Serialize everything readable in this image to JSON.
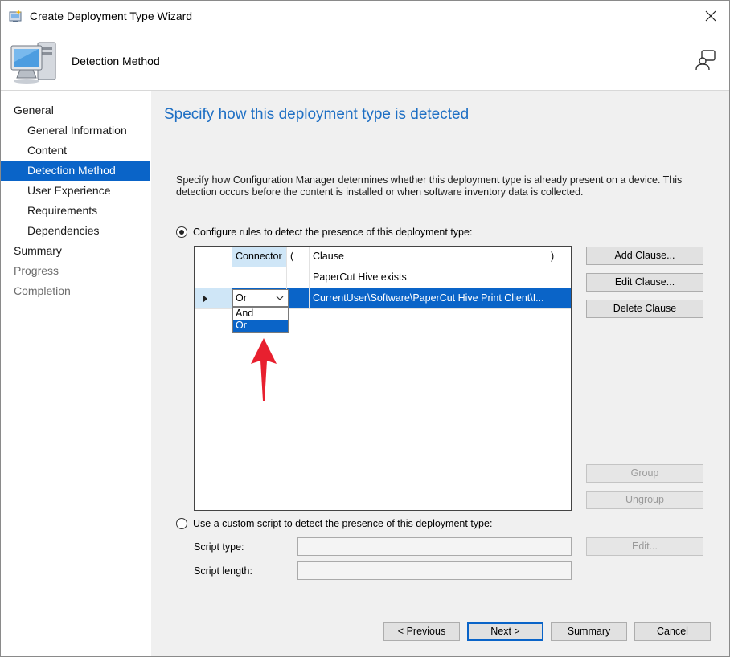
{
  "window": {
    "title": "Create Deployment Type Wizard",
    "close_icon": "close-icon",
    "app_icon": "wizard-icon"
  },
  "header": {
    "title": "Detection Method",
    "icon": "computer-icon",
    "help_icon": "help-person-icon"
  },
  "nav": {
    "items": [
      {
        "label": "General",
        "level": 0,
        "state": "normal"
      },
      {
        "label": "General Information",
        "level": 1,
        "state": "normal"
      },
      {
        "label": "Content",
        "level": 1,
        "state": "normal"
      },
      {
        "label": "Detection Method",
        "level": 1,
        "state": "active"
      },
      {
        "label": "User Experience",
        "level": 1,
        "state": "normal"
      },
      {
        "label": "Requirements",
        "level": 1,
        "state": "normal"
      },
      {
        "label": "Dependencies",
        "level": 1,
        "state": "normal"
      },
      {
        "label": "Summary",
        "level": 0,
        "state": "normal"
      },
      {
        "label": "Progress",
        "level": 0,
        "state": "dim"
      },
      {
        "label": "Completion",
        "level": 0,
        "state": "dim"
      }
    ]
  },
  "main": {
    "heading": "Specify how this deployment type is detected",
    "description": "Specify how Configuration Manager determines whether this deployment type is already present on a device. This detection occurs before the content is installed or when software inventory data is collected.",
    "radio_rules": {
      "label": "Configure rules to detect the presence of this deployment type:",
      "selected": true
    },
    "radio_script": {
      "label": "Use a custom script to detect the presence of this deployment type:",
      "selected": false
    },
    "grid": {
      "columns": [
        "",
        "Connector",
        "(",
        "Clause",
        ")"
      ],
      "rows": [
        {
          "connector": "",
          "open": "",
          "clause": "PaperCut Hive exists",
          "close": ""
        },
        {
          "connector": "Or",
          "open": "",
          "clause": "CurrentUser\\Software\\PaperCut Hive Print Client\\I...",
          "close": ""
        }
      ],
      "connector_options": [
        "And",
        "Or"
      ],
      "connector_selected": "Or"
    },
    "clause_buttons": {
      "add": "Add Clause...",
      "edit": "Edit Clause...",
      "delete": "Delete Clause",
      "group": "Group",
      "ungroup": "Ungroup"
    },
    "script": {
      "type_label": "Script type:",
      "length_label": "Script length:",
      "edit_button": "Edit...",
      "type_value": "",
      "length_value": ""
    },
    "annotation_arrow_color": "#e8202f"
  },
  "footer": {
    "previous": "< Previous",
    "next": "Next >",
    "summary": "Summary",
    "cancel": "Cancel"
  },
  "colors": {
    "accent": "#0a64c8",
    "heading": "#1e6fc4",
    "panel_bg": "#f0f0f0"
  }
}
